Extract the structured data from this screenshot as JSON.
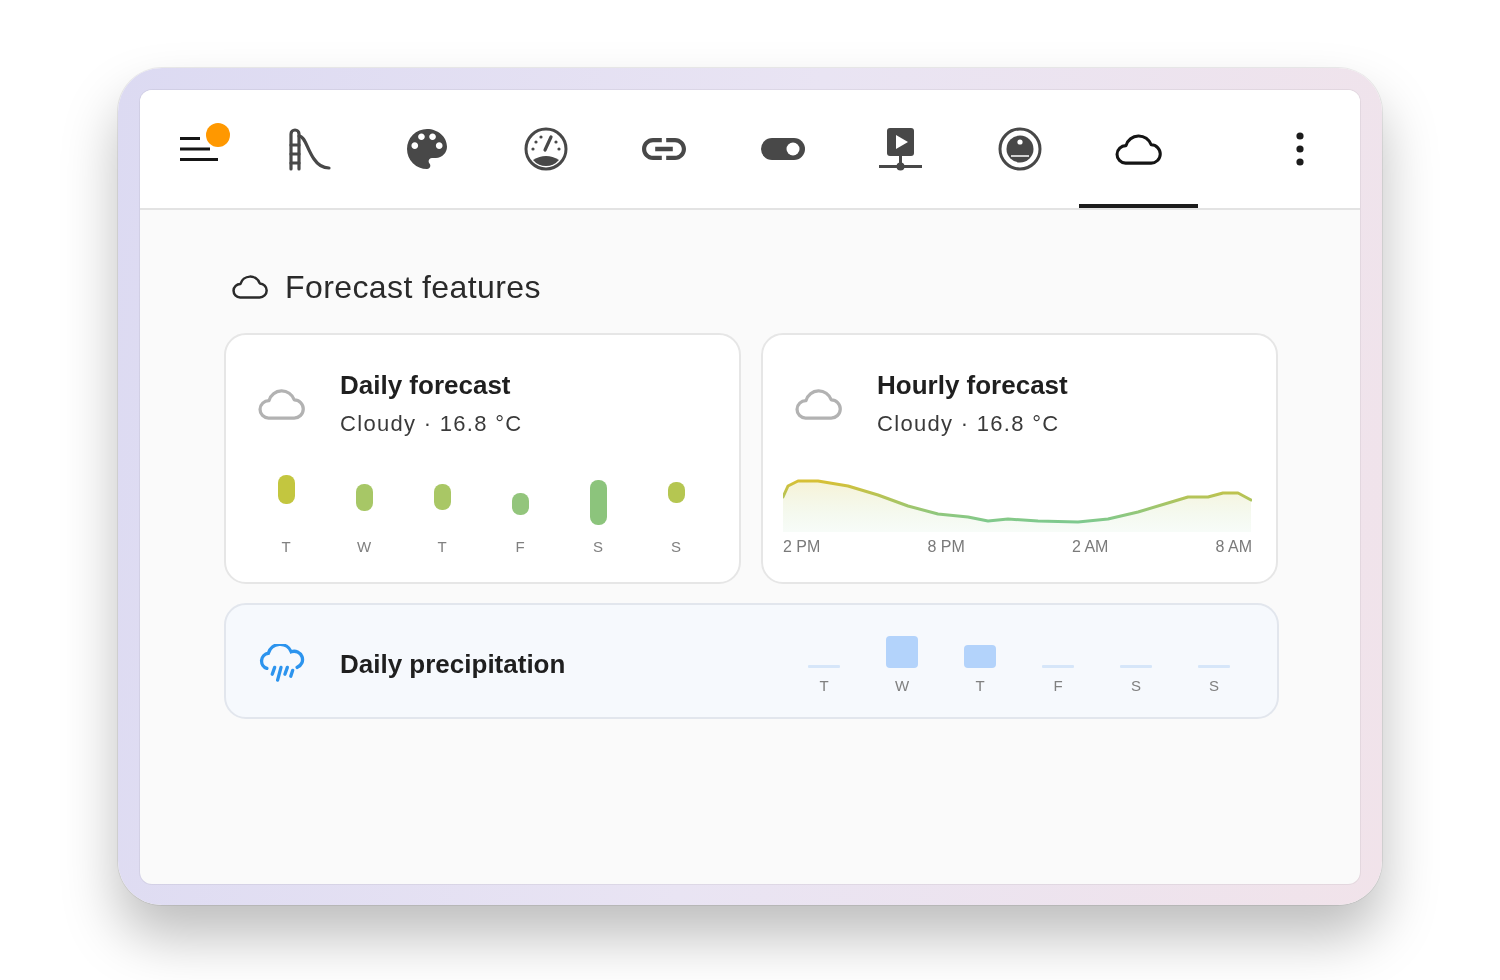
{
  "toolbar": {
    "menu_button": {
      "notification": true
    },
    "tabs": [
      {
        "kind": "slide",
        "selected": false
      },
      {
        "kind": "palette",
        "selected": false
      },
      {
        "kind": "gauge",
        "selected": false
      },
      {
        "kind": "link",
        "selected": false
      },
      {
        "kind": "toggle",
        "selected": false
      },
      {
        "kind": "media",
        "selected": false
      },
      {
        "kind": "robot",
        "selected": false
      },
      {
        "kind": "cloud",
        "selected": true
      }
    ]
  },
  "section": {
    "title": "Forecast features"
  },
  "daily_forecast": {
    "title": "Daily forecast",
    "condition": "Cloudy · 16.8 °C",
    "days": [
      "T",
      "W",
      "T",
      "F",
      "S",
      "S"
    ]
  },
  "hourly_forecast": {
    "title": "Hourly forecast",
    "condition": "Cloudy · 16.8 °C",
    "time_labels": [
      "2 PM",
      "8 PM",
      "2 AM",
      "8 AM"
    ]
  },
  "daily_precipitation": {
    "title": "Daily precipitation",
    "days": [
      "T",
      "W",
      "T",
      "F",
      "S",
      "S"
    ]
  }
}
